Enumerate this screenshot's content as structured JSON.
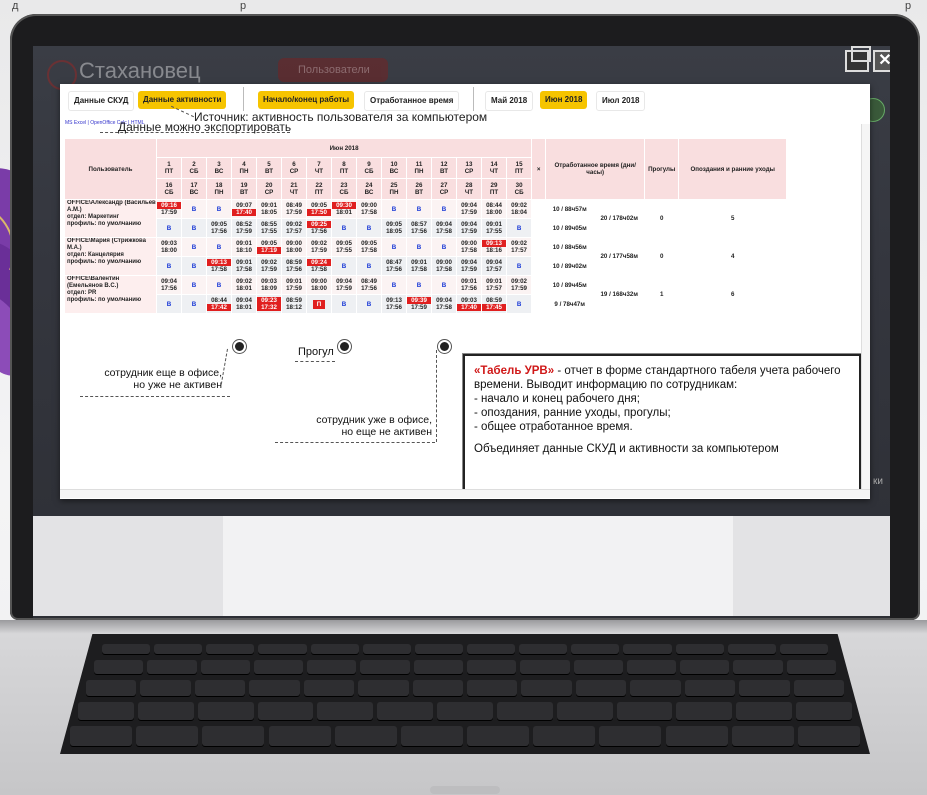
{
  "top_strip": [
    "д",
    "р",
    "р"
  ],
  "app": {
    "title": "Стахановец",
    "button": "Пользователи"
  },
  "tabs": [
    {
      "label": "Данные СКУД",
      "active": false
    },
    {
      "label": "Данные активности",
      "active": true
    },
    {
      "label": "Начало/конец работы",
      "active": true
    },
    {
      "label": "Отработанное время",
      "active": false
    },
    {
      "label": "Май 2018",
      "active": false
    },
    {
      "label": "Июн 2018",
      "active": true
    },
    {
      "label": "Июл 2018",
      "active": false
    }
  ],
  "export_links": "MS Excel | OpenOffice Calc | HTML",
  "notes": {
    "source": "Источник: активность пользователя за компьютером",
    "export": "Данные можно экспортировать"
  },
  "table": {
    "month": "Июн 2018",
    "user_header": "Пользователь",
    "close": "×",
    "worked_header": "Отработанное время (дни/часы)",
    "absences_header": "Прогулы",
    "late_header": "Опоздания и ранние уходы",
    "days_row1": [
      [
        "1",
        "ПТ"
      ],
      [
        "2",
        "СБ"
      ],
      [
        "3",
        "ВС"
      ],
      [
        "4",
        "ПН"
      ],
      [
        "5",
        "ВТ"
      ],
      [
        "6",
        "СР"
      ],
      [
        "7",
        "ЧТ"
      ],
      [
        "8",
        "ПТ"
      ],
      [
        "9",
        "СБ"
      ],
      [
        "10",
        "ВС"
      ],
      [
        "11",
        "ПН"
      ],
      [
        "12",
        "ВТ"
      ],
      [
        "13",
        "СР"
      ],
      [
        "14",
        "ЧТ"
      ],
      [
        "15",
        "ПТ"
      ]
    ],
    "days_row2": [
      [
        "16",
        "СБ"
      ],
      [
        "17",
        "ВС"
      ],
      [
        "18",
        "ПН"
      ],
      [
        "19",
        "ВТ"
      ],
      [
        "20",
        "СР"
      ],
      [
        "21",
        "ЧТ"
      ],
      [
        "22",
        "ПТ"
      ],
      [
        "23",
        "СБ"
      ],
      [
        "24",
        "ВС"
      ],
      [
        "25",
        "ПН"
      ],
      [
        "26",
        "ВТ"
      ],
      [
        "27",
        "СР"
      ],
      [
        "28",
        "ЧТ"
      ],
      [
        "29",
        "ПТ"
      ],
      [
        "30",
        "СБ"
      ]
    ],
    "users": [
      {
        "name": "OFFICE\\Александр (Васильев А.М.)",
        "dept": "отдел: Маркетинг",
        "profile": "профиль: по умолчанию",
        "row1": [
          [
            "09:16",
            "17:59",
            "rt"
          ],
          [
            "В",
            "",
            "b"
          ],
          [
            "В",
            "",
            "b"
          ],
          [
            "09:07",
            "17:40",
            "rb"
          ],
          [
            "09:01",
            "18:05",
            ""
          ],
          [
            "08:49",
            "17:59",
            ""
          ],
          [
            "09:05",
            "17:50",
            "rb"
          ],
          [
            "09:30",
            "18:01",
            "rt"
          ],
          [
            "09:00",
            "17:58",
            ""
          ],
          [
            "В",
            "",
            "b"
          ],
          [
            "В",
            "",
            "b"
          ],
          [
            "В",
            "",
            "b"
          ],
          [
            "09:04",
            "17:59",
            ""
          ],
          [
            "08:44",
            "18:00",
            ""
          ],
          [
            "09:02",
            "18:04",
            ""
          ]
        ],
        "row2": [
          [
            "В",
            "",
            "b"
          ],
          [
            "В",
            "",
            "b"
          ],
          [
            "09:05",
            "17:56",
            ""
          ],
          [
            "08:52",
            "17:59",
            ""
          ],
          [
            "08:55",
            "17:55",
            ""
          ],
          [
            "09:02",
            "17:57",
            ""
          ],
          [
            "09:25",
            "17:56",
            "rt"
          ],
          [
            "В",
            "",
            "b"
          ],
          [
            "В",
            "",
            "b"
          ],
          [
            "09:05",
            "18:05",
            ""
          ],
          [
            "08:57",
            "17:56",
            ""
          ],
          [
            "09:04",
            "17:58",
            ""
          ],
          [
            "09:04",
            "17:59",
            ""
          ],
          [
            "09:01",
            "17:55",
            ""
          ],
          [
            "В",
            "",
            "b"
          ]
        ],
        "worked1": "10 / 88ч57м",
        "worked2": "10 / 89ч05м",
        "worked_total": "20 / 178ч02м",
        "absences": "0",
        "late": "5"
      },
      {
        "name": "OFFICE\\Мария (Стрижкова М.А.)",
        "dept": "отдел: Канцелярия",
        "profile": "профиль: по умолчанию",
        "row1": [
          [
            "09:03",
            "18:00",
            ""
          ],
          [
            "В",
            "",
            "b"
          ],
          [
            "В",
            "",
            "b"
          ],
          [
            "09:01",
            "18:10",
            ""
          ],
          [
            "09:05",
            "17:19",
            "rb"
          ],
          [
            "09:00",
            "18:00",
            ""
          ],
          [
            "09:02",
            "17:59",
            ""
          ],
          [
            "09:05",
            "17:55",
            ""
          ],
          [
            "09:05",
            "17:58",
            ""
          ],
          [
            "В",
            "",
            "b"
          ],
          [
            "В",
            "",
            "b"
          ],
          [
            "В",
            "",
            "b"
          ],
          [
            "09:00",
            "17:58",
            ""
          ],
          [
            "09:13",
            "18:16",
            "rt"
          ],
          [
            "09:02",
            "17:57",
            ""
          ]
        ],
        "row2": [
          [
            "В",
            "",
            "b"
          ],
          [
            "В",
            "",
            "b"
          ],
          [
            "09:13",
            "17:58",
            "rt"
          ],
          [
            "09:01",
            "17:58",
            ""
          ],
          [
            "09:02",
            "17:59",
            ""
          ],
          [
            "08:59",
            "17:56",
            ""
          ],
          [
            "09:24",
            "17:58",
            "rt"
          ],
          [
            "В",
            "",
            "b"
          ],
          [
            "В",
            "",
            "b"
          ],
          [
            "08:47",
            "17:56",
            ""
          ],
          [
            "09:01",
            "17:58",
            ""
          ],
          [
            "09:00",
            "17:58",
            ""
          ],
          [
            "09:04",
            "17:59",
            ""
          ],
          [
            "09:04",
            "17:57",
            ""
          ],
          [
            "В",
            "",
            "b"
          ]
        ],
        "worked1": "10 / 88ч56м",
        "worked2": "10 / 89ч02м",
        "worked_total": "20 / 177ч58м",
        "absences": "0",
        "late": "4"
      },
      {
        "name": "OFFICE\\Валентин (Емельянов В.С.)",
        "dept": "отдел: PR",
        "profile": "профиль: по умолчанию",
        "row1": [
          [
            "09:04",
            "17:56",
            ""
          ],
          [
            "В",
            "",
            "b"
          ],
          [
            "В",
            "",
            "b"
          ],
          [
            "09:02",
            "18:01",
            ""
          ],
          [
            "09:03",
            "18:09",
            ""
          ],
          [
            "09:01",
            "17:59",
            ""
          ],
          [
            "09:00",
            "18:00",
            ""
          ],
          [
            "09:04",
            "17:59",
            ""
          ],
          [
            "08:49",
            "17:56",
            ""
          ],
          [
            "В",
            "",
            "b"
          ],
          [
            "В",
            "",
            "b"
          ],
          [
            "В",
            "",
            "b"
          ],
          [
            "09:01",
            "17:56",
            ""
          ],
          [
            "09:01",
            "17:57",
            ""
          ],
          [
            "09:02",
            "17:59",
            ""
          ]
        ],
        "row2": [
          [
            "В",
            "",
            "b"
          ],
          [
            "В",
            "",
            "b"
          ],
          [
            "08:44",
            "17:42",
            "rb"
          ],
          [
            "09:04",
            "18:01",
            ""
          ],
          [
            "09:23",
            "17:32",
            "rr"
          ],
          [
            "08:59",
            "18:12",
            ""
          ],
          [
            "П",
            "",
            "p"
          ],
          [
            "В",
            "",
            "b"
          ],
          [
            "В",
            "",
            "b"
          ],
          [
            "09:13",
            "17:56",
            ""
          ],
          [
            "09:39",
            "17:59",
            "rt"
          ],
          [
            "09:04",
            "17:58",
            ""
          ],
          [
            "09:03",
            "17:40",
            "rb"
          ],
          [
            "08:59",
            "17:45",
            "rb"
          ],
          [
            "В",
            "",
            "b"
          ]
        ],
        "worked1": "10 / 89ч45м",
        "worked2": "9 / 78ч47м",
        "worked_total": "19 / 168ч32м",
        "absences": "1",
        "late": "6"
      }
    ]
  },
  "callouts": {
    "left": [
      "сотрудник еще в офисе,",
      "но уже не активен"
    ],
    "absence": "Прогул",
    "middle": [
      "сотрудник уже в офисе,",
      "но еще не активен"
    ]
  },
  "info": {
    "title": "«Табель УРВ»",
    "intro": " - отчет в форме стандартного табеля учета рабочего времени. Выводит информацию по сотрудникам:",
    "items": [
      "- начало и конец рабочего дня;",
      "- опоздания, ранние уходы, прогулы;",
      "- общее отработанное время."
    ],
    "footer": "Объединяет данные СКУД и активности за компьютером"
  },
  "side_text": "ки",
  "colors": {
    "tab_active": "#f6c400",
    "late": "#e01f1f",
    "weekend": "#1737d6",
    "header": "#f9dedf"
  }
}
